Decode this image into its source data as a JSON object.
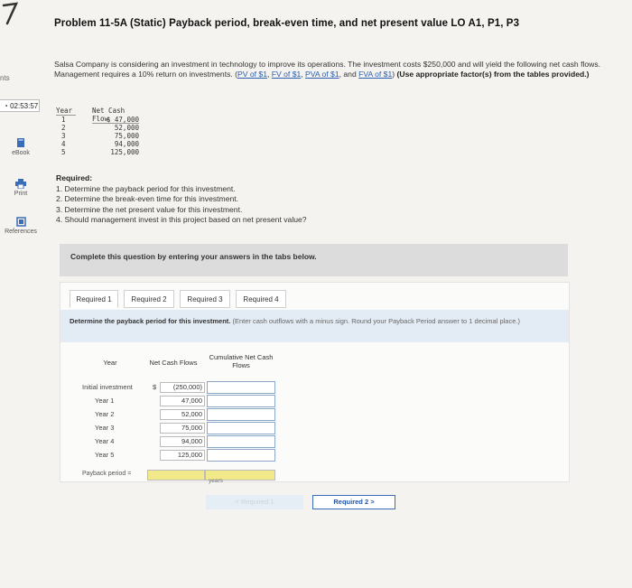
{
  "rail": {
    "tab_fragment": "nts",
    "timer": "02:53:57",
    "ebook_label": "eBook",
    "print_label": "Print",
    "references_label": "References"
  },
  "problem": {
    "title": "Problem 11-5A (Static) Payback period, break-even time, and net present value LO A1, P1, P3",
    "intro_text": "Salsa Company is considering an investment in technology to improve its operations. The investment costs $250,000 and will yield the following net cash flows. Management requires a 10% return on investments.",
    "link_pv": "PV of $1",
    "link_fv": "FV of $1",
    "link_pva": "PVA of $1",
    "link_fva": "FVA of $1",
    "use_factors": "(Use appropriate factor(s) from the tables provided.)"
  },
  "cash_flow_table": {
    "header_year": "Year",
    "header_flow": "Net Cash Flow",
    "years": [
      "1",
      "2",
      "3",
      "4",
      "5"
    ],
    "flows": [
      "$ 47,000",
      "52,000",
      "75,000",
      "94,000",
      "125,000"
    ]
  },
  "required": {
    "heading": "Required:",
    "items": [
      "1. Determine the payback period for this investment.",
      "2. Determine the break-even time for this investment.",
      "3. Determine the net present value for this investment.",
      "4. Should management invest in this project based on net present value?"
    ]
  },
  "banner_text": "Complete this question by entering your answers in the tabs below.",
  "tabs": [
    "Required 1",
    "Required 2",
    "Required 3",
    "Required 4"
  ],
  "instruction": "Determine the payback period for this investment.",
  "instruction_note": "(Enter cash outflows with a minus sign. Round your Payback Period answer to 1 decimal place.)",
  "answer_table": {
    "header_year": "Year",
    "header_ncf": "Net Cash Flows",
    "header_cum": "Cumulative Net Cash Flows",
    "rows": [
      {
        "label": "Initial investment",
        "value": "(250,000)"
      },
      {
        "label": "Year 1",
        "value": "47,000"
      },
      {
        "label": "Year 2",
        "value": "52,000"
      },
      {
        "label": "Year 3",
        "value": "75,000"
      },
      {
        "label": "Year 4",
        "value": "94,000"
      },
      {
        "label": "Year 5",
        "value": "125,000"
      }
    ],
    "currency": "$",
    "payback_label": "Payback period =",
    "years_label": "years"
  },
  "nav": {
    "prev": "< Required 1",
    "next": "Required 2 >"
  }
}
